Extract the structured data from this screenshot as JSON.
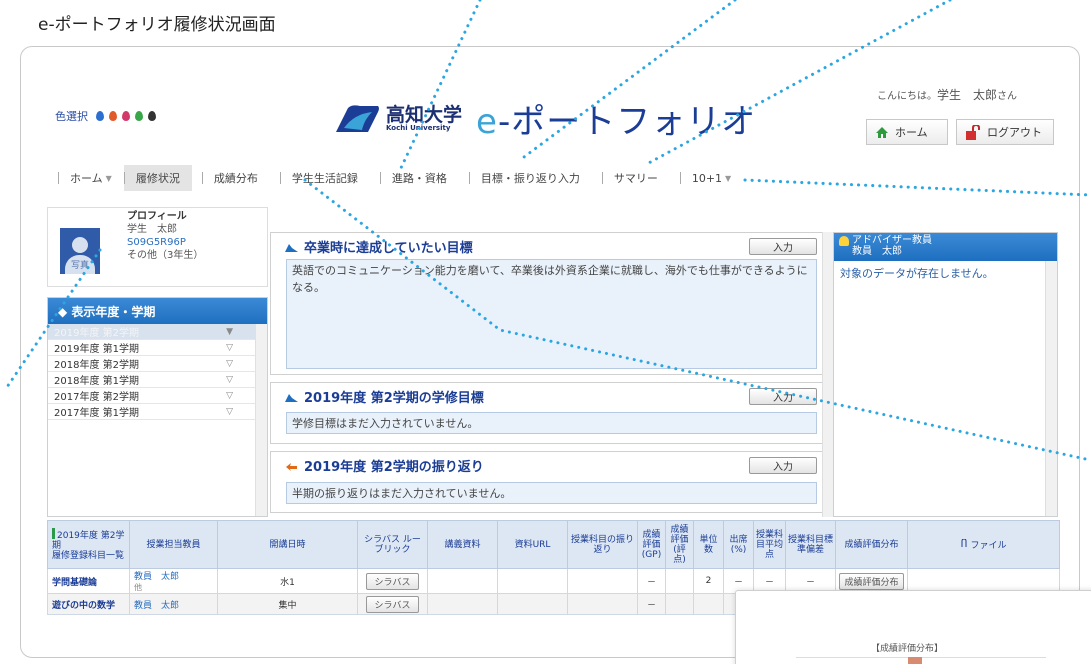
{
  "caption": "e-ポートフォリオ履修状況画面",
  "header": {
    "color_select_label": "色選択",
    "color_drops": [
      "#2c6fd0",
      "#e05a2a",
      "#d23a6a",
      "#3aa64a",
      "#333333"
    ],
    "university": "高知大学",
    "university_en": "Kochi University",
    "app_title_e": "e",
    "app_title": "-ポートフォリオ",
    "greeting_prefix": "こんにちは。",
    "greeting_name": "学生　太郎",
    "greeting_suffix": "さん",
    "home_button": "ホーム",
    "logout_button": "ログアウト"
  },
  "nav": [
    {
      "label": "ホーム",
      "dropdown": true
    },
    {
      "label": "履修状況",
      "active": true
    },
    {
      "label": "成績分布"
    },
    {
      "label": "学生生活記録"
    },
    {
      "label": "進路・資格"
    },
    {
      "label": "目標・振り返り入力"
    },
    {
      "label": "サマリー"
    },
    {
      "label": "10+1",
      "dropdown": true
    }
  ],
  "profile": {
    "title": "プロフィール",
    "name": "学生　太郎",
    "id": "S09G5R96P",
    "category": "その他（3年生）",
    "photo_label": "写真"
  },
  "term_panel": {
    "title": "◆ 表示年度・学期",
    "items": [
      {
        "label": "2019年度 第2学期",
        "selected": true
      },
      {
        "label": "2019年度 第1学期"
      },
      {
        "label": "2018年度 第2学期"
      },
      {
        "label": "2018年度 第1学期"
      },
      {
        "label": "2017年度 第2学期"
      },
      {
        "label": "2017年度 第1学期"
      }
    ]
  },
  "goal_panel": {
    "title": "卒業時に達成していたい目標",
    "input_button": "入力",
    "text": "英語でのコミュニケーション能力を磨いて、卒業後は外資系企業に就職し、海外でも仕事ができるようになる。"
  },
  "semester_goal": {
    "title": "2019年度 第2学期の学修目標",
    "input_button": "入力",
    "text": "学修目標はまだ入力されていません。"
  },
  "reflection": {
    "title": "2019年度 第2学期の振り返り",
    "input_button": "入力",
    "text": "半期の振り返りはまだ入力されていません。"
  },
  "advisor": {
    "role": "アドバイザー教員",
    "name": "教員　太郎",
    "empty_text": "対象のデータが存在しません。"
  },
  "table": {
    "first_header_line1": "2019年度 第2学期",
    "first_header_line2": "履修登録科目一覧",
    "headers": [
      "授業担当教員",
      "開講日時",
      "シラバス ルーブリック",
      "講義資料",
      "資料URL",
      "授業科目の振り返り",
      "成績評価(GP)",
      "成績評価(評点)",
      "単位数",
      "出席(%)",
      "授業科目平均点",
      "授業科目標準偏差",
      "成績評価分布",
      "ファイル"
    ],
    "rows": [
      {
        "course": "学問基礎論",
        "teacher": "教員　太郎",
        "teacher_sub": "他",
        "time": "水1",
        "syllabus": "シラバス",
        "gp": "－",
        "credits": "2",
        "attendance": "－",
        "avg": "－",
        "sd": "－",
        "dist": "成績評価分布"
      },
      {
        "course": "遊びの中の数学",
        "teacher": "教員　太郎",
        "teacher_sub": "",
        "time": "集中",
        "syllabus": "シラバス",
        "gp": "－",
        "credits": "",
        "attendance": "",
        "avg": "",
        "sd": "",
        "dist": ""
      }
    ]
  },
  "overlay": {
    "title": "【成績評価分布】"
  }
}
